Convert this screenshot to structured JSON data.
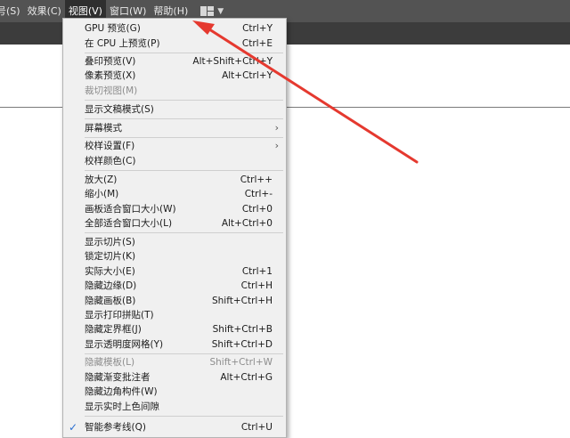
{
  "menubar": {
    "items": [
      {
        "label": "号(S)"
      },
      {
        "label": "效果(C)"
      },
      {
        "label": "视图(V)"
      },
      {
        "label": "窗口(W)"
      },
      {
        "label": "帮助(H)"
      }
    ],
    "workspace_icon": "workspace-layout-icon",
    "chevron_icon": "chevron-down-icon"
  },
  "view_menu": {
    "items": [
      {
        "label": "GPU 预览(G)",
        "shortcut": "Ctrl+Y"
      },
      {
        "label": "在 CPU 上预览(P)",
        "shortcut": "Ctrl+E"
      },
      {
        "label": "叠印预览(V)",
        "shortcut": "Alt+Shift+Ctrl+Y"
      },
      {
        "label": "像素预览(X)",
        "shortcut": "Alt+Ctrl+Y"
      },
      {
        "label": "裁切视图(M)",
        "shortcut": ""
      },
      {
        "label": "显示文稿模式(S)",
        "shortcut": ""
      },
      {
        "label": "屏幕模式",
        "shortcut": ""
      },
      {
        "label": "校样设置(F)",
        "shortcut": ""
      },
      {
        "label": "校样颜色(C)",
        "shortcut": ""
      },
      {
        "label": "放大(Z)",
        "shortcut": "Ctrl++"
      },
      {
        "label": "缩小(M)",
        "shortcut": "Ctrl+-"
      },
      {
        "label": "画板适合窗口大小(W)",
        "shortcut": "Ctrl+0"
      },
      {
        "label": "全部适合窗口大小(L)",
        "shortcut": "Alt+Ctrl+0"
      },
      {
        "label": "显示切片(S)",
        "shortcut": ""
      },
      {
        "label": "锁定切片(K)",
        "shortcut": ""
      },
      {
        "label": "实际大小(E)",
        "shortcut": "Ctrl+1"
      },
      {
        "label": "隐藏边缘(D)",
        "shortcut": "Ctrl+H"
      },
      {
        "label": "隐藏画板(B)",
        "shortcut": "Shift+Ctrl+H"
      },
      {
        "label": "显示打印拼贴(T)",
        "shortcut": ""
      },
      {
        "label": "隐藏定界框(J)",
        "shortcut": "Shift+Ctrl+B"
      },
      {
        "label": "显示透明度网格(Y)",
        "shortcut": "Shift+Ctrl+D"
      },
      {
        "label": "隐藏模板(L)",
        "shortcut": "Shift+Ctrl+W"
      },
      {
        "label": "隐藏渐变批注者",
        "shortcut": "Alt+Ctrl+G"
      },
      {
        "label": "隐藏边角构件(W)",
        "shortcut": ""
      },
      {
        "label": "显示实时上色间隙",
        "shortcut": ""
      },
      {
        "label": "智能参考线(Q)",
        "shortcut": "Ctrl+U"
      }
    ],
    "submenu_icon": "chevron-right-icon",
    "check_icon": "checkmark-icon"
  },
  "colors": {
    "menubar_bg": "#535353",
    "menu_bg": "#f0f0f0",
    "annotation_arrow": "#e5392f"
  }
}
